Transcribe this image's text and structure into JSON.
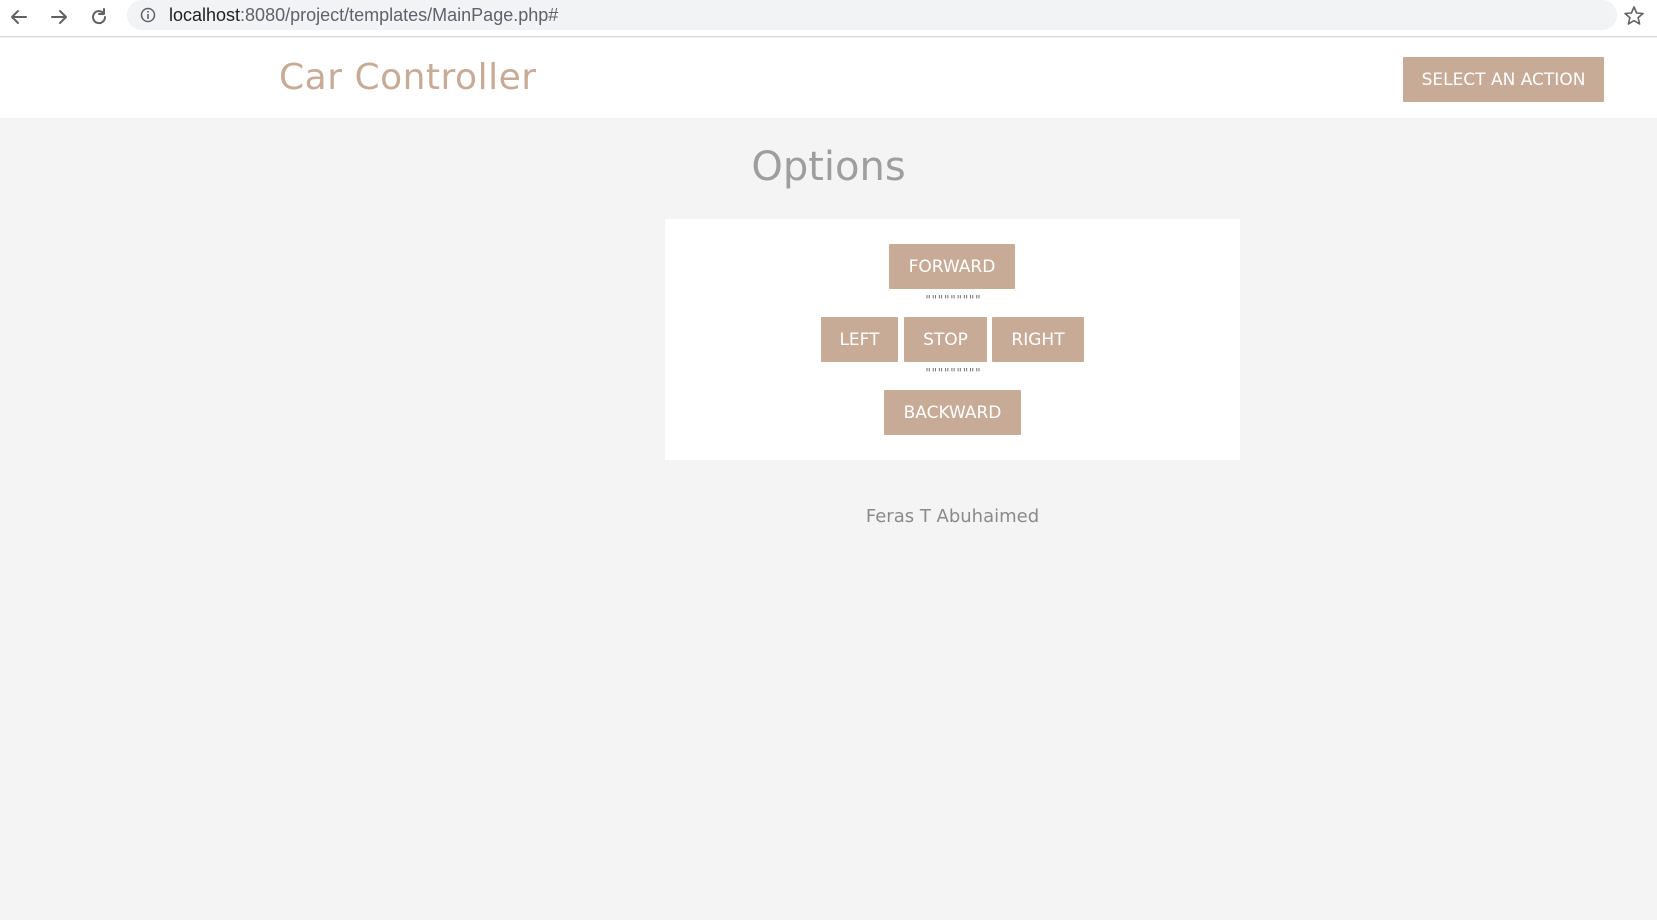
{
  "browser": {
    "url_host": "localhost",
    "url_path": ":8080/project/templates/MainPage.php#",
    "icons": {
      "back": "back-arrow-icon",
      "forward": "forward-arrow-icon",
      "reload": "reload-icon",
      "info": "info-icon",
      "bookmark": "star-icon"
    }
  },
  "header": {
    "brand": "Car Controller",
    "action_button": "SELECT AN ACTION"
  },
  "main": {
    "title": "Options",
    "controls": {
      "forward": "FORWARD",
      "left": "LEFT",
      "stop": "STOP",
      "right": "RIGHT",
      "backward": "BACKWARD"
    },
    "separator_top": "\"\"\"\"\"\"\"\"\"",
    "separator_bottom": "\"\"\"\"\"\"\"\"\""
  },
  "footer": {
    "author": "Feras T Abuhaimed"
  },
  "colors": {
    "accent": "#c8ab97",
    "page_bg": "#f4f4f4",
    "panel_bg": "#ffffff",
    "title_gray": "#9e9e9e"
  }
}
